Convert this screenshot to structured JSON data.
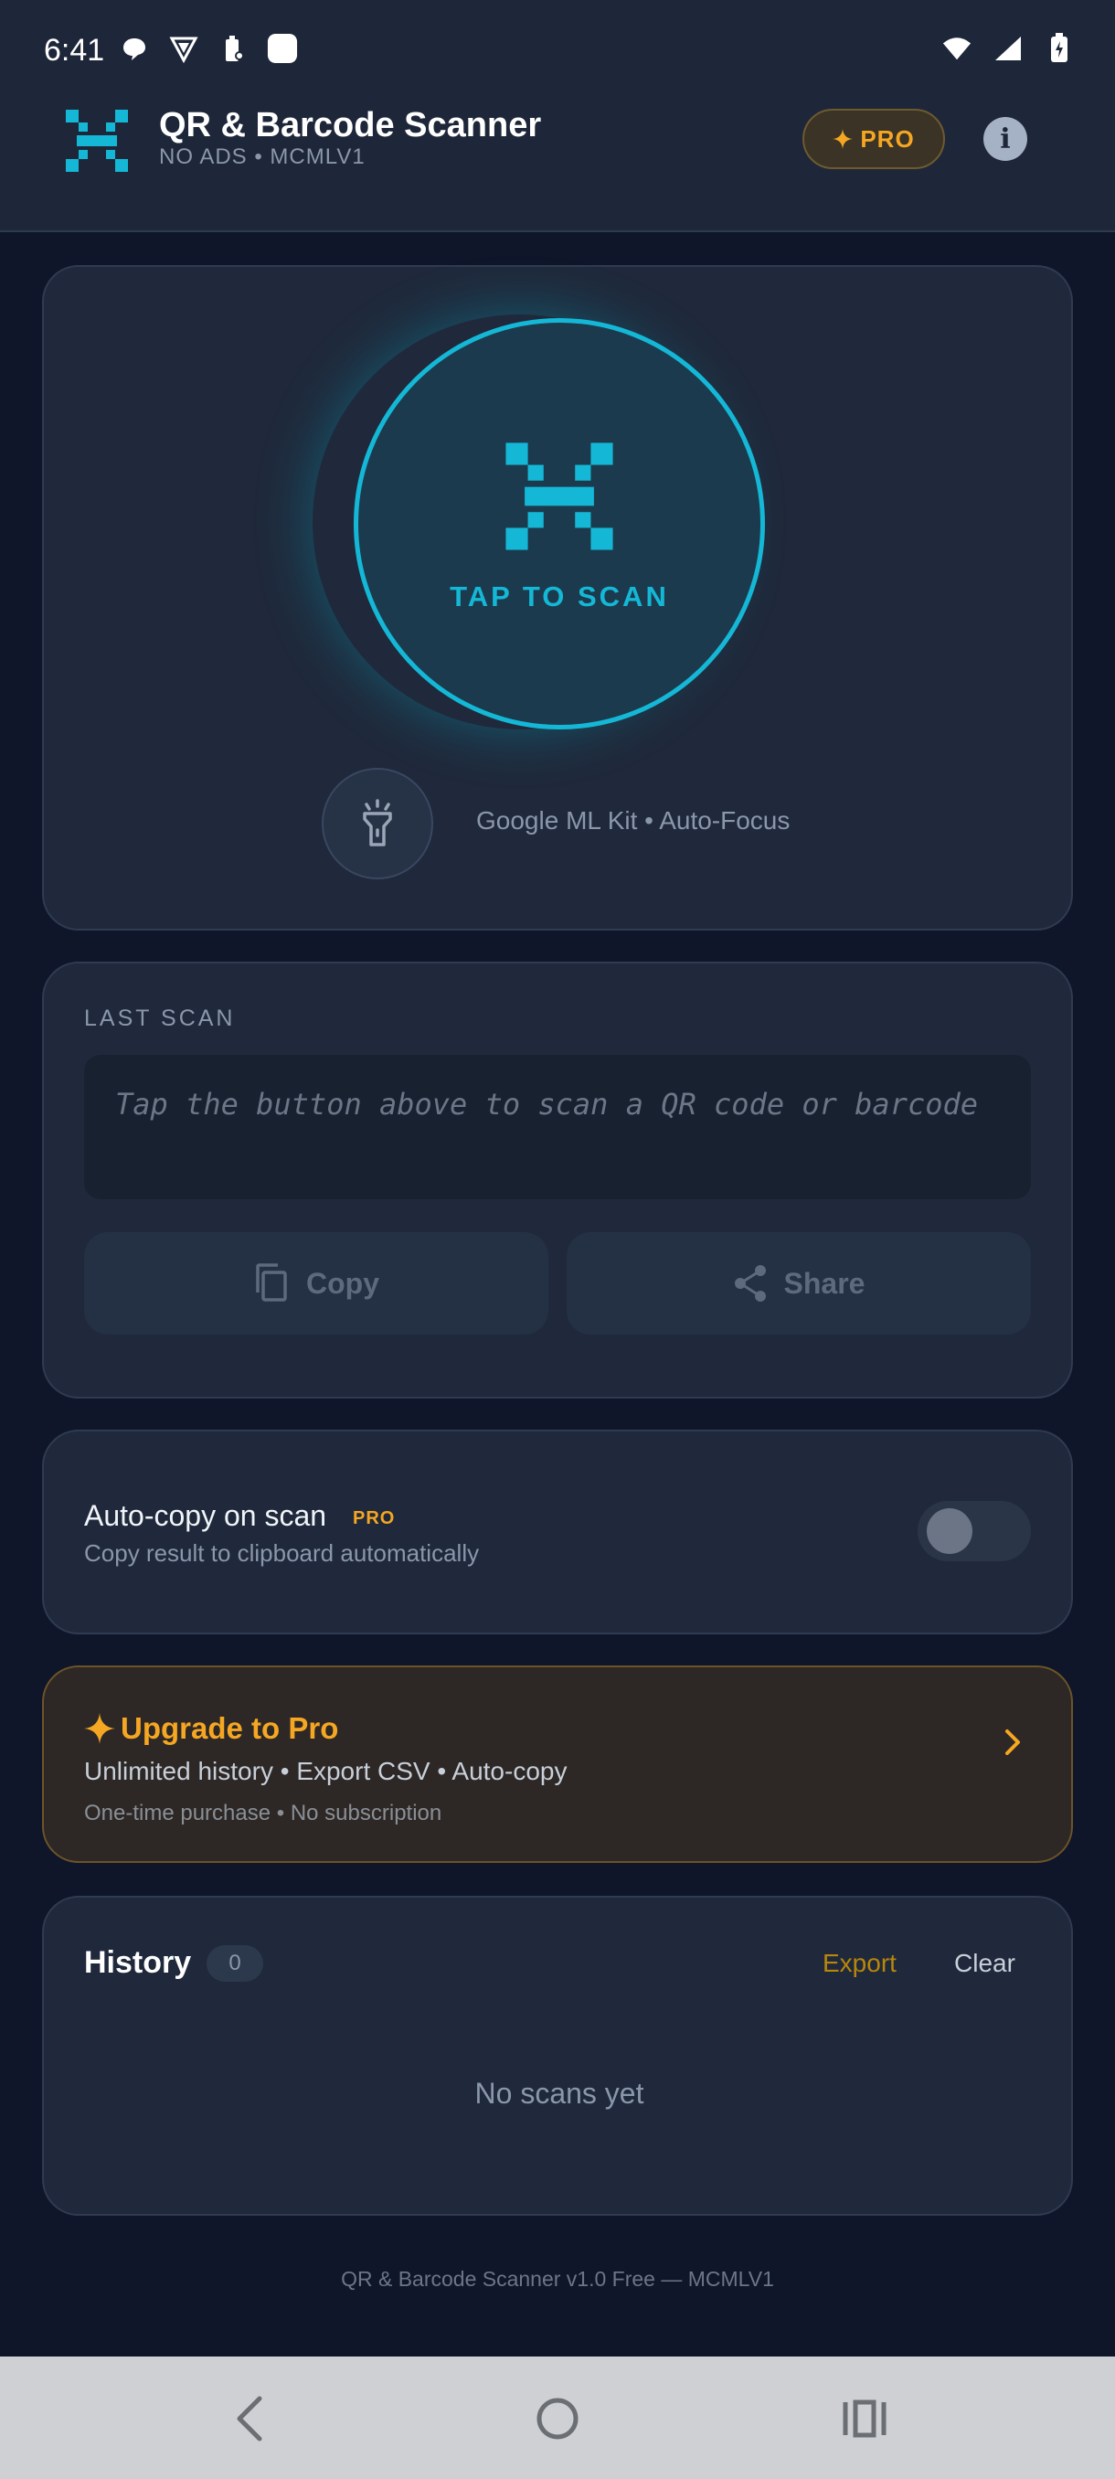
{
  "status_bar": {
    "time": "6:41"
  },
  "header": {
    "title": "QR & Barcode Scanner",
    "subtitle": "NO ADS • MCMLV1",
    "pro_label": "PRO",
    "info_icon": "info-icon"
  },
  "scanner": {
    "label": "TAP TO SCAN",
    "engine_text": "Google ML Kit • Auto-Focus",
    "accent_color": "#14b8d6"
  },
  "last_scan": {
    "section_label": "LAST SCAN",
    "placeholder": "Tap the button above to scan a QR code or barcode",
    "copy_label": "Copy",
    "share_label": "Share"
  },
  "auto_copy": {
    "title": "Auto-copy on scan",
    "pro_tag": "PRO",
    "subtitle": "Copy result to clipboard automatically",
    "enabled": false
  },
  "upgrade": {
    "title": "Upgrade to Pro",
    "features": "Unlimited history • Export CSV • Auto-copy",
    "note": "One-time purchase • No subscription",
    "accent_color": "#f5a623"
  },
  "history": {
    "title": "History",
    "count": "0",
    "export_label": "Export",
    "clear_label": "Clear",
    "empty_text": "No scans yet"
  },
  "footer": {
    "text": "QR & Barcode Scanner v1.0 Free — MCMLV1"
  }
}
